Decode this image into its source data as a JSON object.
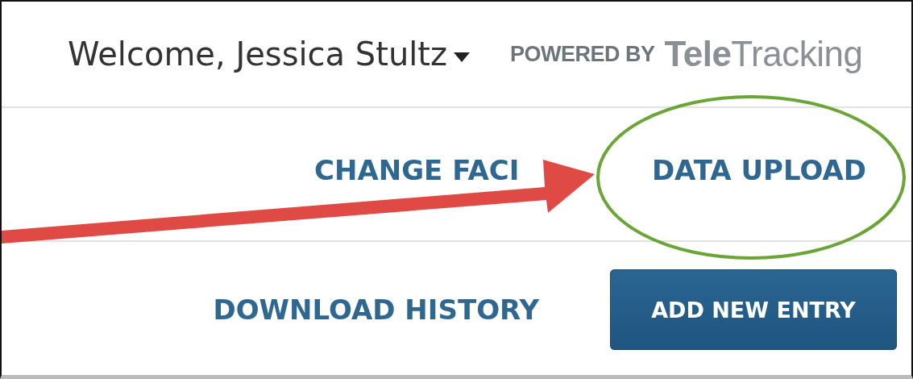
{
  "header": {
    "welcome": "Welcome, Jessica Stultz",
    "powered_by": "POWERED BY",
    "logo": "**Tele**Tracking"
  },
  "nav_links": [
    {
      "label": "CHANGE FACI"
    },
    {
      "label": "DATA UPLOAD"
    }
  ],
  "actions": {
    "link": "DOWNLOAD HISTORY",
    "button": "ADD NEW ENTRY"
  }
}
